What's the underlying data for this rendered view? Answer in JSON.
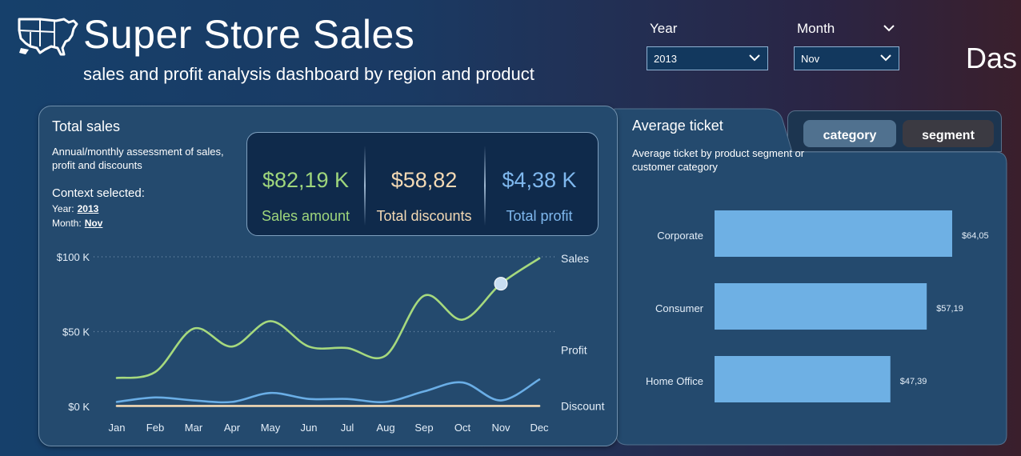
{
  "header": {
    "title": "Super Store Sales",
    "subtitle": "sales and profit analysis dashboard by region and product",
    "logo_icon": "usa-map-icon",
    "cropped_text": "Das"
  },
  "filters": {
    "year_label": "Year",
    "year_value": "2013",
    "month_label": "Month",
    "month_value": "Nov"
  },
  "total_sales_card": {
    "title": "Total sales",
    "description": "Annual/monthly assessment of sales, profit and discounts",
    "context_label": "Context selected:",
    "year_label": "Year:",
    "year_value": "2013",
    "month_label": "Month:",
    "month_value": "Nov",
    "kpis": [
      {
        "value": "$82,19 K",
        "label": "Sales amount",
        "color": "#9fd67c"
      },
      {
        "value": "$58,82",
        "label": "Total discounts",
        "color": "#f3d9b4"
      },
      {
        "value": "$4,38 K",
        "label": "Total profit",
        "color": "#7fb8ee"
      }
    ]
  },
  "average_ticket_card": {
    "title": "Average ticket",
    "description": "Average ticket by product segment or customer category",
    "tabs": [
      "category",
      "segment"
    ],
    "active_tab": "category"
  },
  "chart_data": [
    {
      "type": "line",
      "x": [
        "Jan",
        "Feb",
        "Mar",
        "Apr",
        "May",
        "Jun",
        "Jul",
        "Aug",
        "Sep",
        "Oct",
        "Nov",
        "Dec"
      ],
      "ylim": [
        0,
        100
      ],
      "yticks": [
        "$0 K",
        "$50 K",
        "$100 K"
      ],
      "ytick_values": [
        0,
        50,
        100
      ],
      "grid": true,
      "series": [
        {
          "name": "Sales",
          "color": "#a6d97e",
          "values": [
            19,
            23,
            52,
            40,
            57,
            40,
            39,
            34,
            74,
            58,
            82,
            99
          ]
        },
        {
          "name": "Profit",
          "color": "#6aaee6",
          "values": [
            3,
            6,
            4,
            3,
            9,
            5,
            5,
            3,
            10,
            16,
            4,
            18
          ]
        },
        {
          "name": "Discount",
          "color": "#f3d9b4",
          "values": [
            0.3,
            0.3,
            0.3,
            0.3,
            0.3,
            0.3,
            0.3,
            0.3,
            0.3,
            0.3,
            0.3,
            0.3
          ]
        }
      ],
      "highlight_index": 10
    },
    {
      "type": "bar",
      "orientation": "horizontal",
      "categories": [
        "Corporate",
        "Consumer",
        "Home Office"
      ],
      "values": [
        64.05,
        57.19,
        47.39
      ],
      "value_labels": [
        "$64,05",
        "$57,19",
        "$47,39"
      ],
      "color": "#6eb0e4"
    }
  ]
}
